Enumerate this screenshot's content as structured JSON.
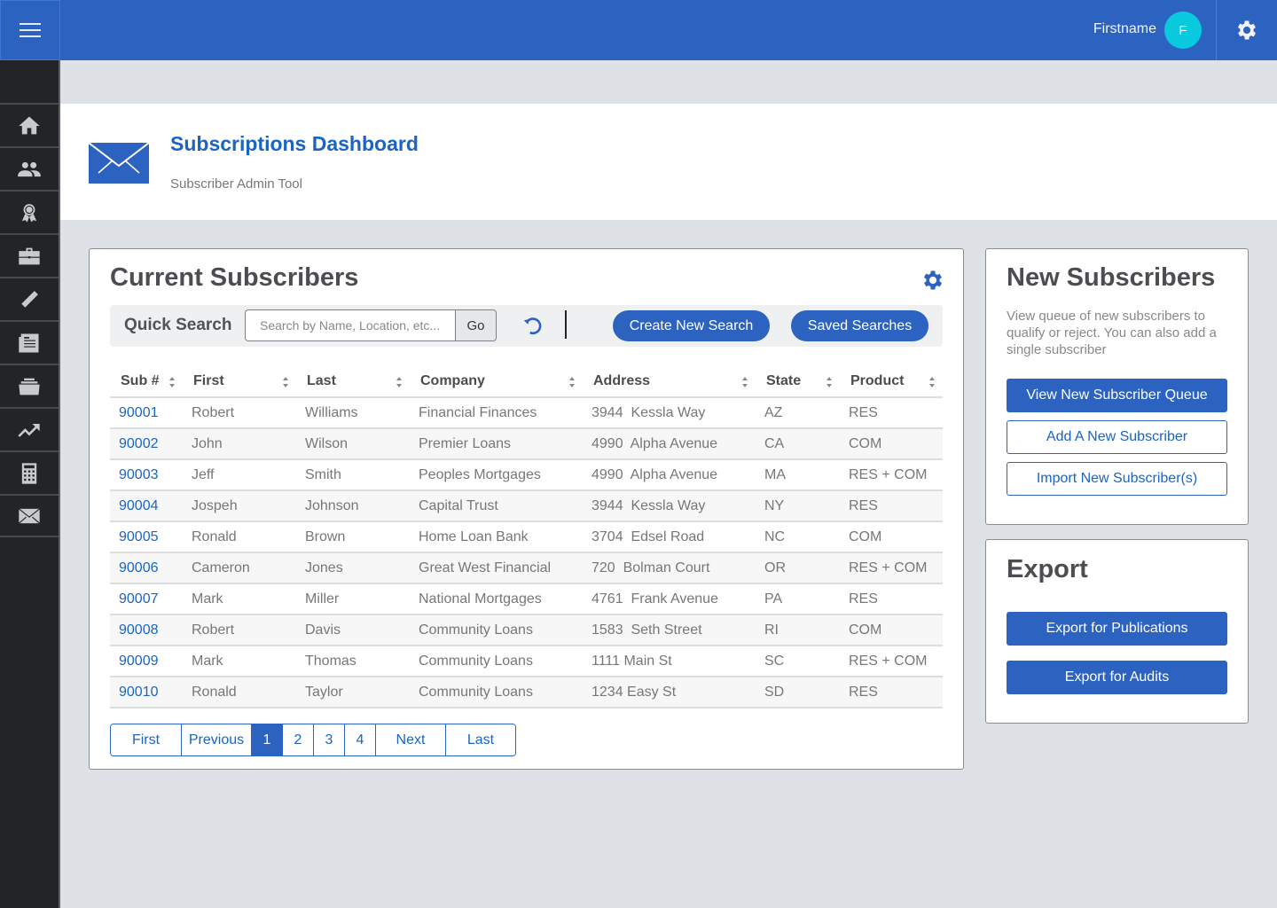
{
  "topbar": {
    "user_name": "Firstname",
    "avatar_initial": "F"
  },
  "sidebar": {
    "items": [
      {
        "icon": "home-icon",
        "label": "Home"
      },
      {
        "icon": "users-icon",
        "label": "Users"
      },
      {
        "icon": "award-icon",
        "label": "Awards"
      },
      {
        "icon": "briefcase-icon",
        "label": "Business"
      },
      {
        "icon": "pencil-icon",
        "label": "Edit"
      },
      {
        "icon": "newspaper-icon",
        "label": "Publications"
      },
      {
        "icon": "archive-icon",
        "label": "Archive"
      },
      {
        "icon": "trending-icon",
        "label": "Analytics"
      },
      {
        "icon": "calculator-icon",
        "label": "Calculator"
      },
      {
        "icon": "mail-icon",
        "label": "Subscriptions"
      }
    ]
  },
  "header": {
    "title": "Subscriptions Dashboard",
    "subtitle": "Subscriber Admin Tool"
  },
  "current_subscribers": {
    "title": "Current Subscribers",
    "quick_search_label": "Quick Search",
    "search_placeholder": "Search by Name, Location, etc...",
    "search_value": "",
    "go_label": "Go",
    "create_new_search_label": "Create New Search",
    "saved_searches_label": "Saved Searches",
    "columns": [
      "Sub #",
      "First",
      "Last",
      "Company",
      "Address",
      "State",
      "Product"
    ],
    "rows": [
      [
        "90001",
        "Robert",
        "Williams",
        "Financial Finances",
        "3944  Kessla Way",
        "AZ",
        "RES"
      ],
      [
        "90002",
        "John",
        "Wilson",
        "Premier Loans",
        "4990  Alpha Avenue",
        "CA",
        "COM"
      ],
      [
        "90003",
        "Jeff",
        "Smith",
        "Peoples Mortgages",
        "4990  Alpha Avenue",
        "MA",
        "RES + COM"
      ],
      [
        "90004",
        "Jospeh",
        "Johnson",
        "Capital Trust",
        "3944  Kessla Way",
        "NY",
        "RES"
      ],
      [
        "90005",
        "Ronald",
        "Brown",
        "Home Loan Bank",
        "3704  Edsel Road",
        "NC",
        "COM"
      ],
      [
        "90006",
        "Cameron",
        "Jones",
        "Great West Financial",
        "720  Bolman Court",
        "OR",
        "RES + COM"
      ],
      [
        "90007",
        "Mark",
        "Miller",
        "National Mortgages",
        "4761  Frank Avenue",
        "PA",
        "RES"
      ],
      [
        "90008",
        "Robert",
        "Davis",
        "Community Loans",
        "1583  Seth Street",
        "RI",
        "COM"
      ],
      [
        "90009",
        "Mark",
        "Thomas",
        "Community Loans",
        "1111 Main St",
        "SC",
        "RES + COM"
      ],
      [
        "90010",
        "Ronald",
        "Taylor",
        "Community Loans",
        "1234 Easy St",
        "SD",
        "RES"
      ]
    ],
    "pagination": {
      "first": "First",
      "previous": "Previous",
      "pages": [
        "1",
        "2",
        "3",
        "4"
      ],
      "current_page": "1",
      "next": "Next",
      "last": "Last"
    }
  },
  "new_subscribers": {
    "title": "New Subscribers",
    "description": "View queue of new subscribers to qualify or reject. You can also add a single subscriber",
    "view_queue_label": "View New Subscriber Queue",
    "add_label": "Add A New Subscriber",
    "import_label": "Import New Subscriber(s)"
  },
  "export": {
    "title": "Export",
    "publications_label": "Export for Publications",
    "audits_label": "Export for Audits"
  },
  "colors": {
    "brand_blue": "#2d63c0",
    "link_blue": "#1b64c2",
    "avatar_cyan": "#09c9df",
    "sidebar_dark": "#222428",
    "page_bg": "#dee1e5"
  }
}
